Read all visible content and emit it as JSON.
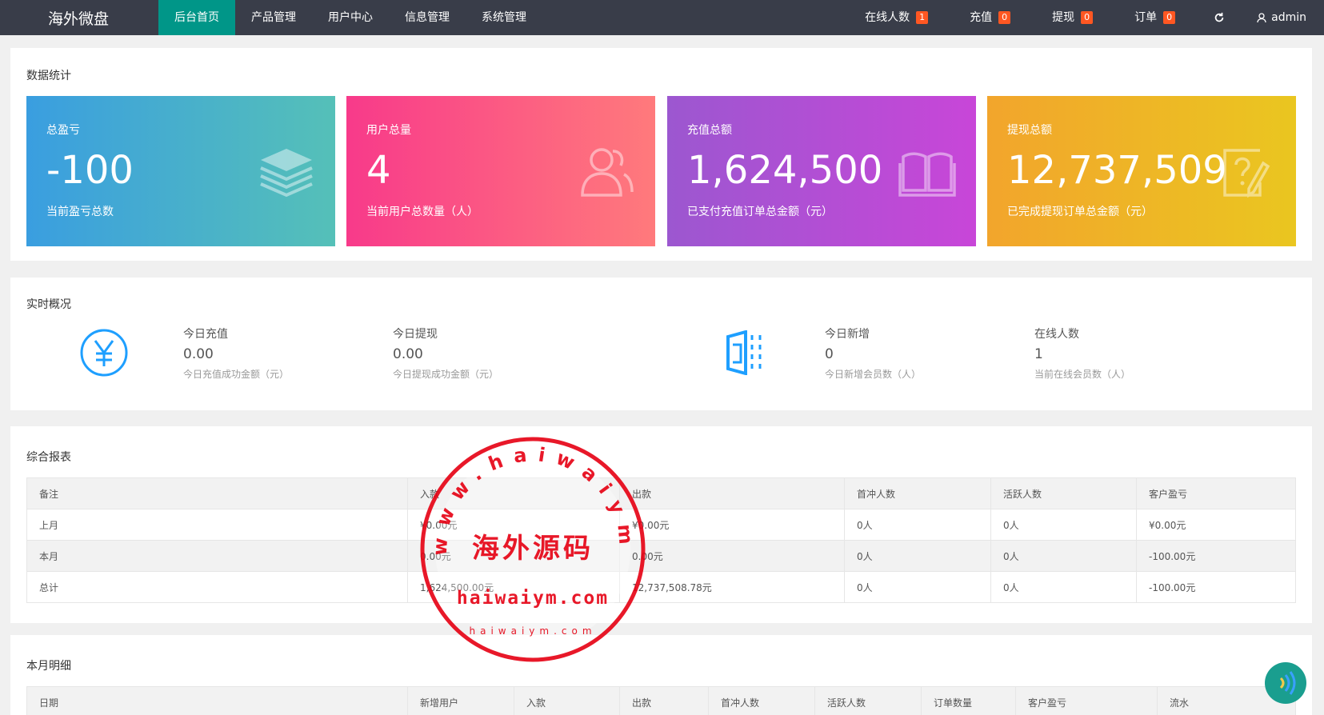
{
  "app": {
    "logo": "海外微盘"
  },
  "nav": {
    "items": [
      {
        "label": "后台首页",
        "active": true
      },
      {
        "label": "产品管理",
        "active": false
      },
      {
        "label": "用户中心",
        "active": false
      },
      {
        "label": "信息管理",
        "active": false
      },
      {
        "label": "系统管理",
        "active": false
      }
    ]
  },
  "header_right": {
    "online": {
      "label": "在线人数",
      "count": "1"
    },
    "recharge": {
      "label": "充值",
      "count": "0"
    },
    "withdraw": {
      "label": "提现",
      "count": "0"
    },
    "orders": {
      "label": "订单",
      "count": "0"
    },
    "user": "admin"
  },
  "stats": {
    "title": "数据统计",
    "boxes": [
      {
        "title": "总盈亏",
        "value": "-100",
        "desc": "当前盈亏总数",
        "icon": "layers-icon",
        "gradient": [
          "#3a9ee0",
          "#55c0b8"
        ]
      },
      {
        "title": "用户总量",
        "value": "4",
        "desc": "当前用户总数量（人）",
        "icon": "users-icon",
        "gradient": [
          "#f83a8a",
          "#ff7a7c"
        ]
      },
      {
        "title": "充值总额",
        "value": "1,624,500",
        "desc": "已支付充值订单总金额（元）",
        "icon": "book-icon",
        "gradient": [
          "#9c57d0",
          "#c846d8"
        ]
      },
      {
        "title": "提现总额",
        "value": "12,737,509",
        "desc": "已完成提现订单总金额（元）",
        "icon": "edit-icon",
        "gradient": [
          "#f2a52c",
          "#eac620"
        ]
      }
    ]
  },
  "realtime": {
    "title": "实时概况",
    "items": [
      {
        "title": "今日充值",
        "value": "0.00",
        "desc": "今日充值成功金额（元）"
      },
      {
        "title": "今日提现",
        "value": "0.00",
        "desc": "今日提现成功金额（元）"
      },
      {
        "title": "今日新增",
        "value": "0",
        "desc": "今日新增会员数（人）"
      },
      {
        "title": "在线人数",
        "value": "1",
        "desc": "当前在线会员数（人）"
      }
    ]
  },
  "report": {
    "title": "综合报表",
    "headers": [
      "备注",
      "入款",
      "出款",
      "首冲人数",
      "活跃人数",
      "客户盈亏"
    ],
    "rows": [
      [
        "上月",
        "¥0.00元",
        "¥0.00元",
        "0人",
        "0人",
        "¥0.00元"
      ],
      [
        "本月",
        "0.00元",
        "0.00元",
        "0人",
        "0人",
        "-100.00元"
      ],
      [
        "总计",
        "1,624,500.00元",
        "12,737,508.78元",
        "0人",
        "0人",
        "-100.00元"
      ]
    ]
  },
  "monthly": {
    "title": "本月明细",
    "headers": [
      "日期",
      "新增用户",
      "入款",
      "出款",
      "首冲人数",
      "活跃人数",
      "订单数量",
      "客户盈亏",
      "流水"
    ]
  },
  "stamp": {
    "ring_text": "www.haiwaiym.com",
    "center_text": "海外源码",
    "domain": "haiwaiym.com",
    "small": "haiwaiym.com"
  },
  "colors": {
    "topbar": "#393d49",
    "active_nav": "#009688",
    "badge": "#ff5722",
    "stamp": "#e60012"
  }
}
